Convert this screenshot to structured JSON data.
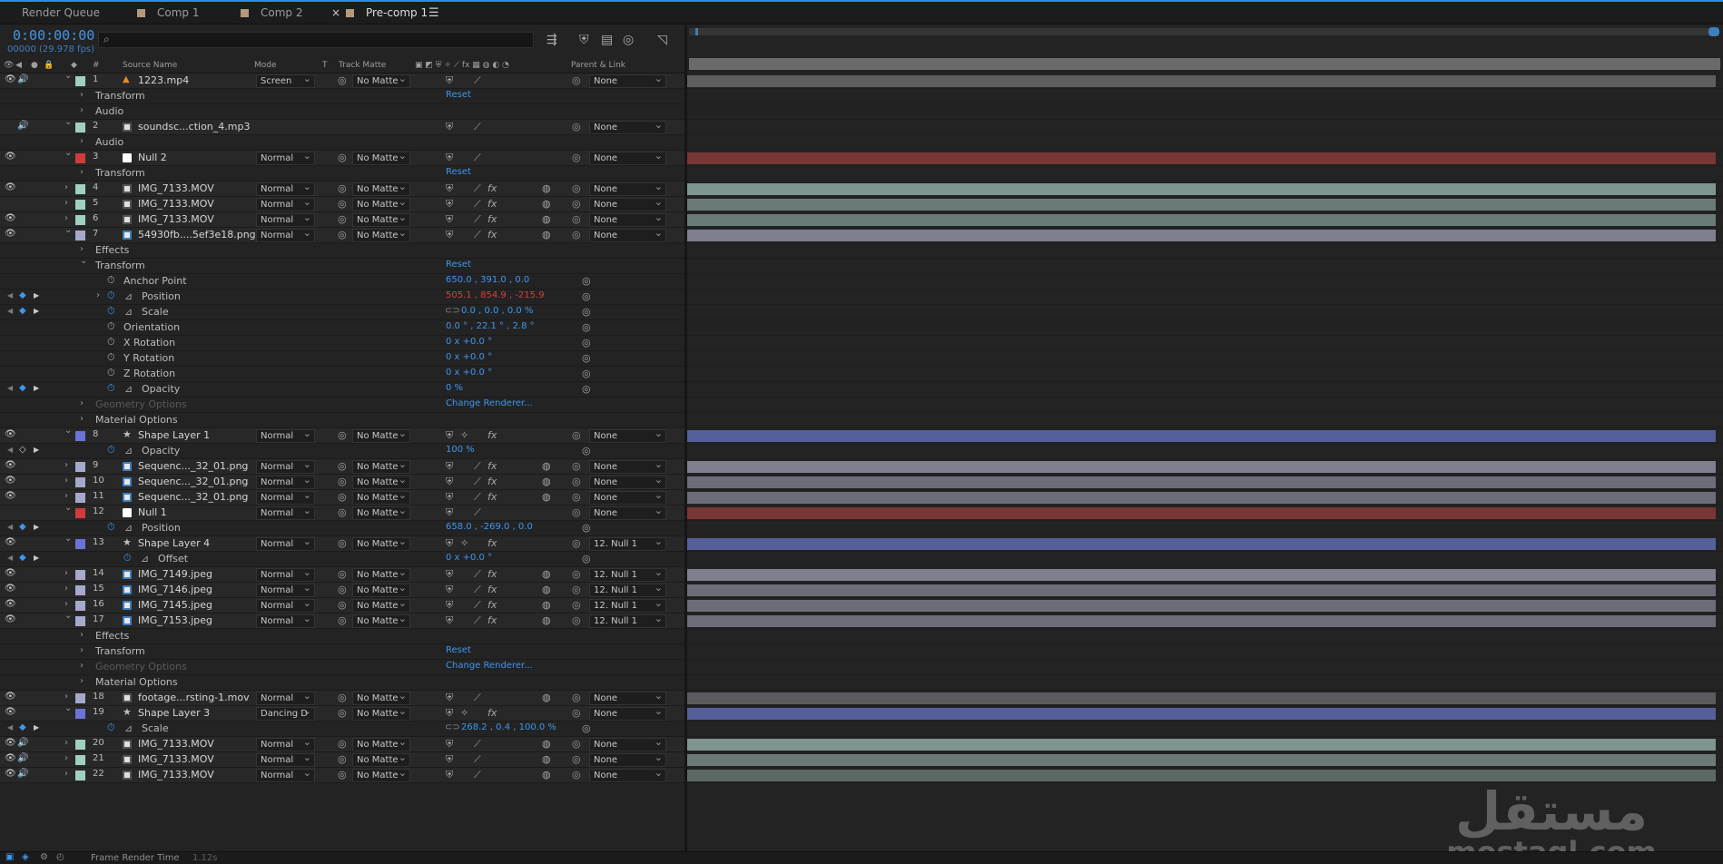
{
  "tabs": {
    "render_queue": "Render Queue",
    "comp1": "Comp 1",
    "comp2": "Comp 2",
    "precomp1": "Pre-comp 1",
    "close_glyph": "×",
    "menu_glyph": "☰"
  },
  "timeline": {
    "timecode": "0:00:00:00",
    "frames": "00000 (29.978 fps)",
    "search_placeholder": "",
    "search_glyph": "⌕"
  },
  "columns": {
    "num": "#",
    "source_name": "Source Name",
    "mode": "Mode",
    "t": "T",
    "track_matte": "Track Matte",
    "parent_link": "Parent & Link"
  },
  "rows": [
    {
      "kind": "layer",
      "num": "1",
      "name": "1223.mp4",
      "type": "cone",
      "label": "#9fd0c0",
      "mode": "Screen",
      "matte": "No Matte",
      "parent": "None",
      "eye": true,
      "audio": true,
      "expanded": true,
      "fx": false
    },
    {
      "kind": "prop",
      "name": "Transform",
      "indent": 1,
      "chev": true,
      "value": "Reset"
    },
    {
      "kind": "prop",
      "name": "Audio",
      "indent": 1,
      "chev": true
    },
    {
      "kind": "layer",
      "num": "2",
      "name": "soundsc...ction_4.mp3",
      "type": "audio",
      "label": "#9fd0c0",
      "mode": "",
      "matte": "",
      "parent": "None",
      "eye": false,
      "audio": true,
      "expanded": true,
      "fx": false
    },
    {
      "kind": "prop",
      "name": "Audio",
      "indent": 1,
      "chev": true
    },
    {
      "kind": "layer",
      "num": "3",
      "name": "Null 2",
      "type": "solid",
      "label": "#d23b3b",
      "mode": "Normal",
      "matte": "No Matte",
      "parent": "None",
      "eye": true,
      "audio": false,
      "expanded": true,
      "fx": false
    },
    {
      "kind": "prop",
      "name": "Transform",
      "indent": 1,
      "chev": true,
      "value": "Reset"
    },
    {
      "kind": "layer",
      "num": "4",
      "name": "IMG_7133.MOV",
      "type": "footage",
      "label": "#9fd0c0",
      "mode": "Normal",
      "matte": "No Matte",
      "parent": "None",
      "eye": true,
      "audio": false,
      "expanded": false,
      "fx": true
    },
    {
      "kind": "layer",
      "num": "5",
      "name": "IMG_7133.MOV",
      "type": "footage",
      "label": "#9fd0c0",
      "mode": "Normal",
      "matte": "No Matte",
      "parent": "None",
      "eye": false,
      "audio": false,
      "expanded": false,
      "fx": true
    },
    {
      "kind": "layer",
      "num": "6",
      "name": "IMG_7133.MOV",
      "type": "footage",
      "label": "#9fd0c0",
      "mode": "Normal",
      "matte": "No Matte",
      "parent": "None",
      "eye": true,
      "audio": false,
      "expanded": false,
      "fx": true
    },
    {
      "kind": "layer",
      "num": "7",
      "name": "54930fb....5ef3e18.png",
      "type": "image",
      "label": "#a8a8cc",
      "mode": "Normal",
      "matte": "No Matte",
      "parent": "None",
      "eye": true,
      "audio": false,
      "expanded": true,
      "fx": true
    },
    {
      "kind": "prop",
      "name": "Effects",
      "indent": 1,
      "chev": true
    },
    {
      "kind": "prop",
      "name": "Transform",
      "indent": 1,
      "chev": true,
      "open": true,
      "value": "Reset"
    },
    {
      "kind": "prop",
      "name": "Anchor Point",
      "indent": 2,
      "stopwatch": true,
      "value": "650.0 , 391.0 , 0.0"
    },
    {
      "kind": "prop",
      "name": "Position",
      "indent": 2,
      "stopwatch": true,
      "active": true,
      "graph": true,
      "chev": true,
      "kf": true,
      "value": "505.1 , 854.9 , -215.9",
      "red": true
    },
    {
      "kind": "prop",
      "name": "Scale",
      "indent": 2,
      "stopwatch": true,
      "active": true,
      "graph": true,
      "kf": true,
      "link": true,
      "value": "0.0 , 0.0 , 0.0 %"
    },
    {
      "kind": "prop",
      "name": "Orientation",
      "indent": 2,
      "stopwatch": true,
      "value": "0.0 ° , 22.1 ° , 2.8 °"
    },
    {
      "kind": "prop",
      "name": "X Rotation",
      "indent": 2,
      "stopwatch": true,
      "value": "0 x +0.0 °"
    },
    {
      "kind": "prop",
      "name": "Y Rotation",
      "indent": 2,
      "stopwatch": true,
      "value": "0 x +0.0 °"
    },
    {
      "kind": "prop",
      "name": "Z Rotation",
      "indent": 2,
      "stopwatch": true,
      "value": "0 x +0.0 °"
    },
    {
      "kind": "prop",
      "name": "Opacity",
      "indent": 2,
      "stopwatch": true,
      "active": true,
      "graph": true,
      "kf": true,
      "value": "0 %"
    },
    {
      "kind": "prop",
      "name": "Geometry Options",
      "indent": 1,
      "chev": true,
      "dim": true,
      "value": "Change Renderer..."
    },
    {
      "kind": "prop",
      "name": "Material Options",
      "indent": 1,
      "chev": true
    },
    {
      "kind": "layer",
      "num": "8",
      "name": "Shape Layer 1",
      "type": "star",
      "label": "#6a73d6",
      "mode": "Normal",
      "matte": "No Matte",
      "parent": "None",
      "eye": true,
      "audio": false,
      "expanded": true,
      "fx": true,
      "shape": true
    },
    {
      "kind": "prop",
      "name": "Opacity",
      "indent": 2,
      "stopwatch": true,
      "active": true,
      "graph": true,
      "kfhollow": true,
      "value": "100 %"
    },
    {
      "kind": "layer",
      "num": "9",
      "name": "Sequenc..._32_01.png",
      "type": "image",
      "label": "#a8a8cc",
      "mode": "Normal",
      "matte": "No Matte",
      "parent": "None",
      "eye": true,
      "audio": false,
      "expanded": false,
      "fx": true
    },
    {
      "kind": "layer",
      "num": "10",
      "name": "Sequenc..._32_01.png",
      "type": "image",
      "label": "#a8a8cc",
      "mode": "Normal",
      "matte": "No Matte",
      "parent": "None",
      "eye": true,
      "audio": false,
      "expanded": false,
      "fx": true
    },
    {
      "kind": "layer",
      "num": "11",
      "name": "Sequenc..._32_01.png",
      "type": "image",
      "label": "#a8a8cc",
      "mode": "Normal",
      "matte": "No Matte",
      "parent": "None",
      "eye": true,
      "audio": false,
      "expanded": false,
      "fx": true
    },
    {
      "kind": "layer",
      "num": "12",
      "name": "Null 1",
      "type": "solid",
      "label": "#d23b3b",
      "mode": "Normal",
      "matte": "No Matte",
      "parent": "None",
      "eye": false,
      "audio": false,
      "expanded": true,
      "fx": false
    },
    {
      "kind": "prop",
      "name": "Position",
      "indent": 2,
      "stopwatch": true,
      "active": true,
      "graph": true,
      "kf": true,
      "value": "658.0 , -269.0 , 0.0"
    },
    {
      "kind": "layer",
      "num": "13",
      "name": "Shape Layer 4",
      "type": "star",
      "label": "#6a73d6",
      "mode": "Normal",
      "matte": "No Matte",
      "parent": "12. Null 1",
      "eye": true,
      "audio": false,
      "expanded": true,
      "fx": true,
      "shape": true
    },
    {
      "kind": "prop",
      "name": "Offset",
      "indent": 3,
      "stopwatch": true,
      "active": true,
      "graph": true,
      "kf": true,
      "value": "0 x +0.0 °"
    },
    {
      "kind": "layer",
      "num": "14",
      "name": "IMG_7149.jpeg",
      "type": "image",
      "label": "#a8a8cc",
      "mode": "Normal",
      "matte": "No Matte",
      "parent": "12. Null 1",
      "eye": true,
      "audio": false,
      "expanded": false,
      "fx": true
    },
    {
      "kind": "layer",
      "num": "15",
      "name": "IMG_7146.jpeg",
      "type": "image",
      "label": "#a8a8cc",
      "mode": "Normal",
      "matte": "No Matte",
      "parent": "12. Null 1",
      "eye": true,
      "audio": false,
      "expanded": false,
      "fx": true
    },
    {
      "kind": "layer",
      "num": "16",
      "name": "IMG_7145.jpeg",
      "type": "image",
      "label": "#a8a8cc",
      "mode": "Normal",
      "matte": "No Matte",
      "parent": "12. Null 1",
      "eye": true,
      "audio": false,
      "expanded": false,
      "fx": true
    },
    {
      "kind": "layer",
      "num": "17",
      "name": "IMG_7153.jpeg",
      "type": "image",
      "label": "#a8a8cc",
      "mode": "Normal",
      "matte": "No Matte",
      "parent": "12. Null 1",
      "eye": true,
      "audio": false,
      "expanded": true,
      "fx": true
    },
    {
      "kind": "prop",
      "name": "Effects",
      "indent": 1,
      "chev": true
    },
    {
      "kind": "prop",
      "name": "Transform",
      "indent": 1,
      "chev": true,
      "value": "Reset"
    },
    {
      "kind": "prop",
      "name": "Geometry Options",
      "indent": 1,
      "chev": true,
      "dim": true,
      "value": "Change Renderer..."
    },
    {
      "kind": "prop",
      "name": "Material Options",
      "indent": 1,
      "chev": true
    },
    {
      "kind": "layer",
      "num": "18",
      "name": "footage...rsting-1.mov",
      "type": "footage",
      "label": "#a8a8cc",
      "mode": "Normal",
      "matte": "No Matte",
      "parent": "None",
      "eye": true,
      "audio": false,
      "expanded": false,
      "fx": false
    },
    {
      "kind": "layer",
      "num": "19",
      "name": "Shape Layer 3",
      "type": "star",
      "label": "#6a73d6",
      "mode": "Dancing D",
      "matte": "No Matte",
      "parent": "None",
      "eye": true,
      "audio": false,
      "expanded": true,
      "fx": true,
      "shape": true
    },
    {
      "kind": "prop",
      "name": "Scale",
      "indent": 2,
      "stopwatch": true,
      "active": true,
      "graph": true,
      "kf": true,
      "link": true,
      "value": "268.2 , 0.4 , 100.0 %"
    },
    {
      "kind": "layer",
      "num": "20",
      "name": "IMG_7133.MOV",
      "type": "footage",
      "label": "#9fd0c0",
      "mode": "Normal",
      "matte": "No Matte",
      "parent": "None",
      "eye": true,
      "audio": true,
      "expanded": false,
      "fx": false
    },
    {
      "kind": "layer",
      "num": "21",
      "name": "IMG_7133.MOV",
      "type": "footage",
      "label": "#9fd0c0",
      "mode": "Normal",
      "matte": "No Matte",
      "parent": "None",
      "eye": true,
      "audio": true,
      "expanded": false,
      "fx": false
    },
    {
      "kind": "layer",
      "num": "22",
      "name": "IMG_7133.MOV",
      "type": "footage",
      "label": "#9fd0c0",
      "mode": "Normal",
      "matte": "No Matte",
      "parent": "None",
      "eye": true,
      "audio": true,
      "expanded": false,
      "fx": false
    }
  ],
  "bar_colors": {
    "1": "#5e5e5e",
    "3": "#7a3535",
    "4": "#7f9590",
    "5": "#6a7b77",
    "6": "#6a7b77",
    "7": "#7f7f8f",
    "8": "#55609a",
    "9": "#7f7f8f",
    "10": "#6d6d7a",
    "11": "#6d6d7a",
    "12": "#7a3535",
    "13": "#55609a",
    "14": "#7f7f8f",
    "15": "#6d6d7a",
    "16": "#6d6d7a",
    "17": "#6d6d7a",
    "18": "#5a5a5f",
    "19": "#55609a",
    "20": "#7f9590",
    "21": "#6a7b77",
    "22": "#5b6965"
  },
  "watermark": {
    "arabic": "مستقل",
    "latin": "mostaql.com"
  },
  "footer": {
    "frame_render_label": "Frame Render Time",
    "frame_render_value": "1.12s"
  },
  "colors": {
    "accent": "#3d97ee",
    "keyframe_value_red": "#d4403e"
  }
}
